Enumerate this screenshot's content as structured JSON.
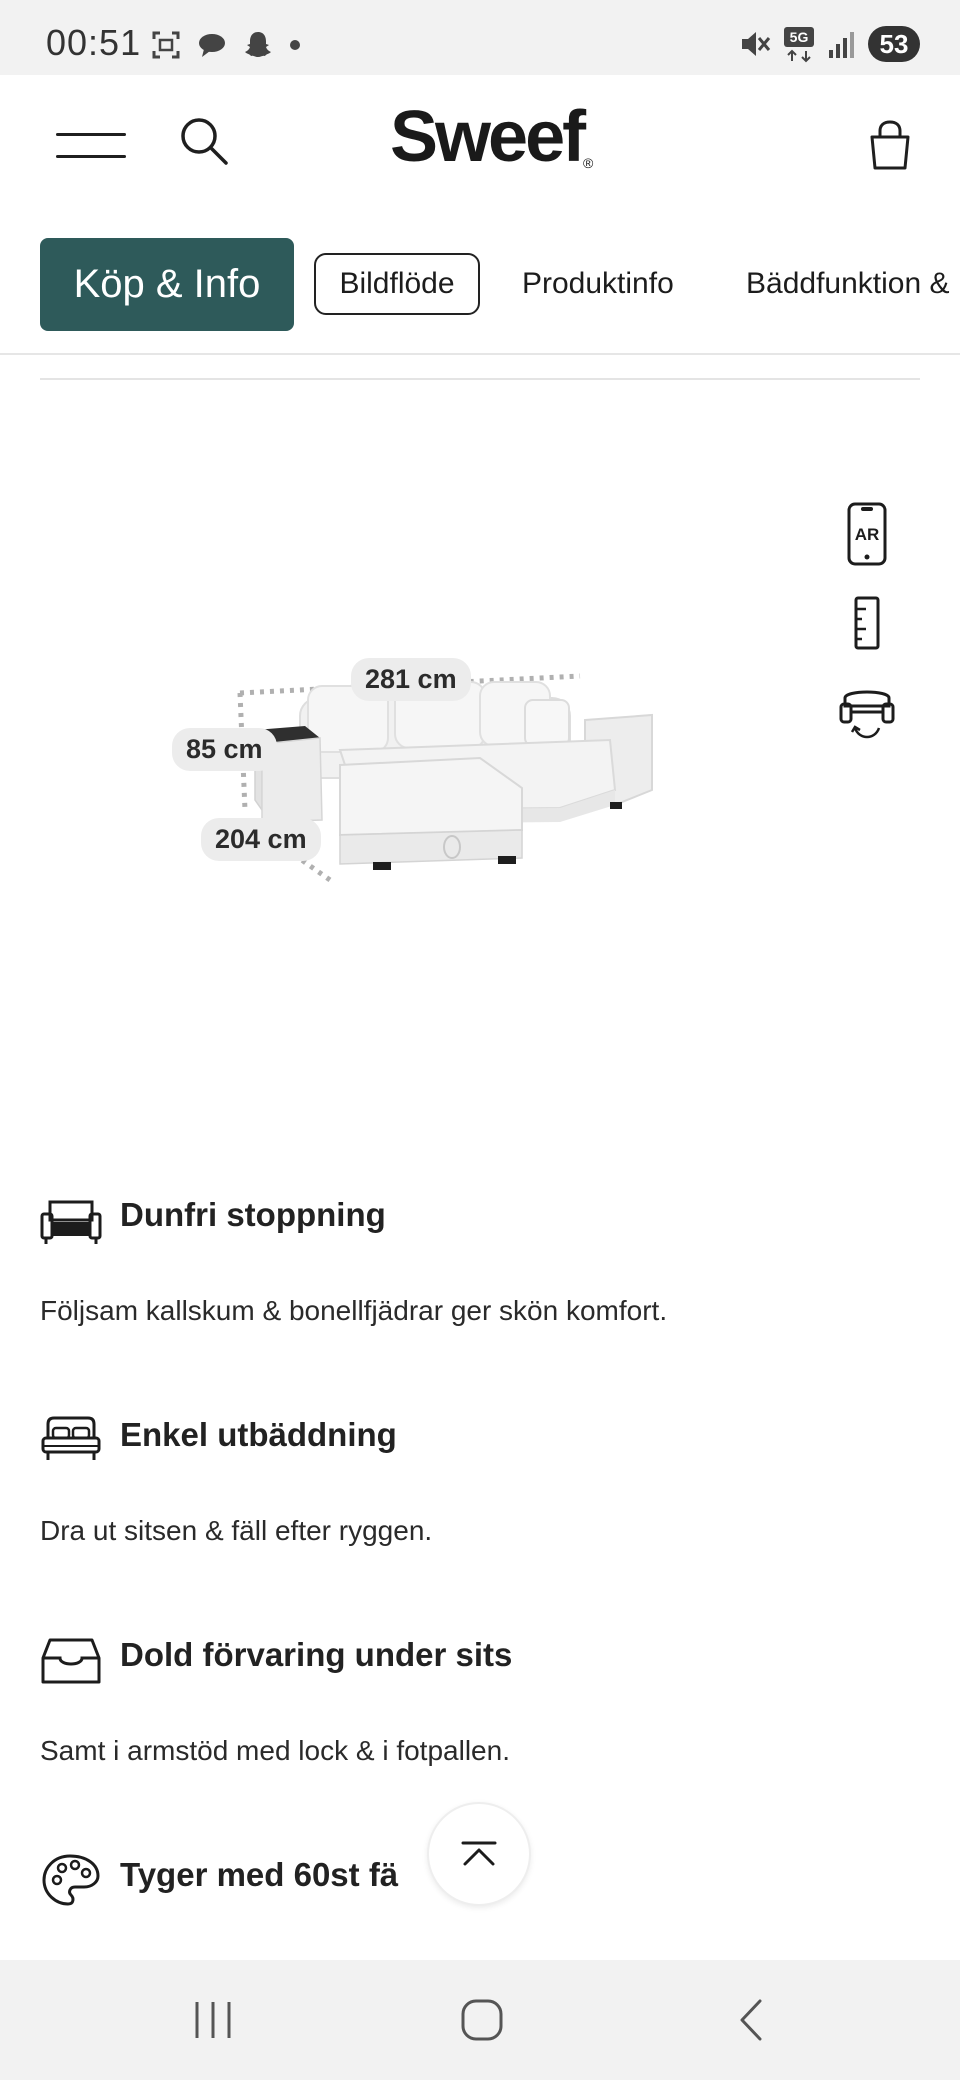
{
  "status_bar": {
    "time": "00:51",
    "battery": "53",
    "network": "5G"
  },
  "header": {
    "logo": "Sweef",
    "logo_mark": "®",
    "icons": [
      "menu-icon",
      "search-icon",
      "shopping-bag-icon"
    ]
  },
  "tabs": [
    {
      "label": "Köp & Info",
      "active": true
    },
    {
      "label": "Bildflöde",
      "active": false
    },
    {
      "label": "Produktinfo",
      "active": false
    },
    {
      "label": "Bäddfunktion &",
      "active": false
    }
  ],
  "product": {
    "dimensions": {
      "width": "281 cm",
      "height": "85 cm",
      "depth": "204 cm"
    },
    "tools": [
      {
        "name": "ar-view-icon",
        "label": "AR"
      },
      {
        "name": "ruler-icon",
        "label": ""
      },
      {
        "name": "rotate-sofa-icon",
        "label": ""
      }
    ]
  },
  "features": [
    {
      "title": "Dunfri stoppning",
      "desc": "Följsam kallskum & bonellfjädrar ger skön komfort.",
      "icon": "sofa-icon"
    },
    {
      "title": "Enkel utbäddning",
      "desc": "Dra ut sitsen & fäll efter ryggen.",
      "icon": "bed-icon"
    },
    {
      "title": "Dold förvaring under sits",
      "desc": "Samt i armstöd med lock & i fotpallen.",
      "icon": "storage-tray-icon"
    },
    {
      "title": "Tyger med 60st fä",
      "desc": "",
      "icon": "palette-icon"
    }
  ],
  "colors": {
    "accent": "#2e5a5a",
    "status_bar": "#f2f2f2"
  }
}
